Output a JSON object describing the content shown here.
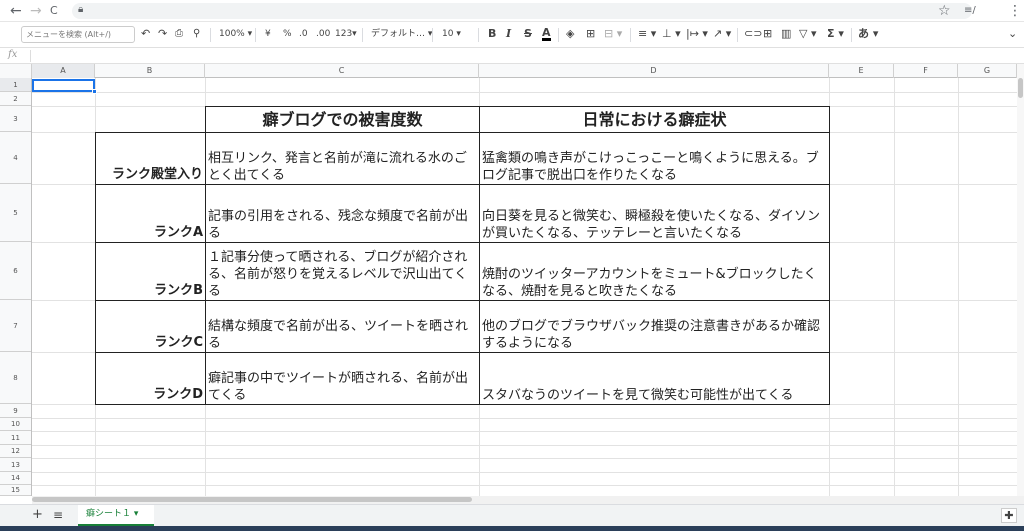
{
  "browser": {
    "back": "←",
    "forward": "→",
    "reload": "C",
    "star": "☆",
    "reading_list": "≡/",
    "menu": "⋮"
  },
  "toolbar": {
    "menu_search_placeholder": "メニューを検索 (Alt+/)",
    "zoom": "100%",
    "currency": "¥",
    "percent": "%",
    "dec_less": ".0",
    "dec_more": ".00",
    "format_123": "123▾",
    "font": "デフォルト…",
    "font_size": "10",
    "bold": "B",
    "italic": "I",
    "strike": "S",
    "textcolor": "A",
    "sum": "Σ",
    "input_tool": "あ"
  },
  "formula_bar": {
    "fx": "fx",
    "value": ""
  },
  "columns": [
    "A",
    "B",
    "C",
    "D",
    "E",
    "F",
    "G"
  ],
  "rows": [
    "1",
    "2",
    "3",
    "4",
    "5",
    "6",
    "7",
    "8",
    "9",
    "10",
    "11",
    "12",
    "13",
    "14",
    "15"
  ],
  "table": {
    "header_c": "癖ブログでの被害度数",
    "header_d": "日常における癖症状",
    "rows": [
      {
        "rank": "ランク殿堂入り",
        "damage": "相互リンク、発言と名前が滝に流れる水のごとく出てくる",
        "symptom": "猛禽類の鳴き声がこけっこっこーと鳴くように思える。ブログ記事で脱出口を作りたくなる"
      },
      {
        "rank": "ランクA",
        "damage": "記事の引用をされる、残念な頻度で名前が出る",
        "symptom": "向日葵を見ると微笑む、瞬極殺を使いたくなる、ダイソンが買いたくなる、テッテレーと言いたくなる"
      },
      {
        "rank": "ランクB",
        "damage": "１記事分使って晒される、ブログが紹介される、名前が怒りを覚えるレベルで沢山出てくる",
        "symptom": "焼酎のツイッターアカウントをミュート&ブロックしたくなる、焼酎を見ると吹きたくなる"
      },
      {
        "rank": "ランクC",
        "damage": "結構な頻度で名前が出る、ツイートを晒される",
        "symptom": "他のブログでブラウザバック推奨の注意書きがあるか確認するようになる"
      },
      {
        "rank": "ランクD",
        "damage": "癖記事の中でツイートが晒される、名前が出てくる",
        "symptom": "スタバなうのツイートを見て微笑む可能性が出てくる"
      }
    ]
  },
  "sheet_bar": {
    "add": "+",
    "list": "≡",
    "tab_label": "癖シート１ ▾",
    "explore": "✚"
  }
}
